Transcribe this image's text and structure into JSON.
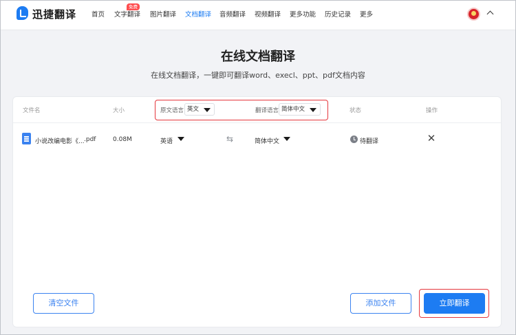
{
  "brand": {
    "name": "迅捷翻译"
  },
  "nav": {
    "items": [
      "首页",
      "文字翻译",
      "图片翻译",
      "文档翻译",
      "音频翻译",
      "视频翻译",
      "更多功能",
      "历史记录",
      "更多"
    ],
    "free_badge": "免费",
    "active_index": 3
  },
  "header": {
    "title": "在线文档翻译",
    "subtitle": "在线文档翻译，一键即可翻译word、execl、ppt、pdf文档内容"
  },
  "table": {
    "columns": {
      "filename": "文件名",
      "size": "大小",
      "source_lang": "原文语言",
      "target_lang": "翻译语言",
      "status": "状态",
      "action": "操作"
    },
    "source_lang_value": "英文",
    "target_lang_value": "简体中文",
    "rows": [
      {
        "filename": "小说改编电影《...",
        "ext": ".pdf",
        "size": "0.08M",
        "source": "英语",
        "target": "简体中文",
        "status": "待翻译"
      }
    ]
  },
  "buttons": {
    "clear": "清空文件",
    "add": "添加文件",
    "translate": "立即翻译"
  },
  "colors": {
    "accent": "#1d7cf2",
    "highlight": "#e5353b",
    "badge": "#ff4d4f"
  }
}
